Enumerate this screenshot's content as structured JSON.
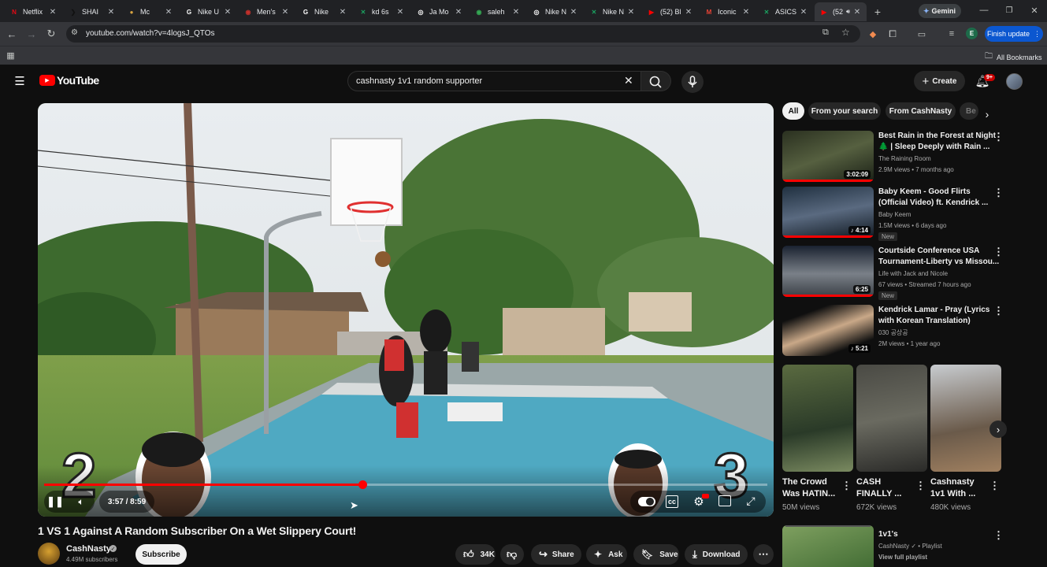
{
  "browser": {
    "tabs": [
      {
        "label": "Netflix",
        "icon": "netflix-icon",
        "color": "#e50914",
        "glyph": "N"
      },
      {
        "label": "SHAI",
        "icon": "shai-icon",
        "color": "#111111",
        "glyph": "❯"
      },
      {
        "label": "Mc",
        "icon": "mc-icon",
        "color": "#d9a441",
        "glyph": "●"
      },
      {
        "label": "Nike U",
        "icon": "google-g-icon",
        "color": "#ffffff",
        "glyph": "G"
      },
      {
        "label": "Men's",
        "icon": "mens-icon",
        "color": "#c4302b",
        "glyph": "◉"
      },
      {
        "label": "Nike",
        "icon": "google-g-icon",
        "color": "#ffffff",
        "glyph": "G"
      },
      {
        "label": "kd 6s",
        "icon": "x-icon",
        "color": "#1aa260",
        "glyph": "✕"
      },
      {
        "label": "Ja Mo",
        "icon": "chatgpt-icon",
        "color": "#ffffff",
        "glyph": "◎"
      },
      {
        "label": "saleh",
        "icon": "chrome-icon",
        "color": "#34a853",
        "glyph": "◉"
      },
      {
        "label": "Nike N",
        "icon": "chatgpt-icon",
        "color": "#ffffff",
        "glyph": "◎"
      },
      {
        "label": "Nike N",
        "icon": "x-icon",
        "color": "#1aa260",
        "glyph": "✕"
      },
      {
        "label": "(52) Bl",
        "icon": "youtube-icon",
        "color": "#ff0000",
        "glyph": "▶"
      },
      {
        "label": "Iconic",
        "icon": "gmail-icon",
        "color": "#ea4335",
        "glyph": "M"
      },
      {
        "label": "ASICS",
        "icon": "x-icon",
        "color": "#1aa260",
        "glyph": "✕"
      },
      {
        "label": "(52",
        "icon": "youtube-icon",
        "color": "#ff0000",
        "glyph": "▶"
      }
    ],
    "gemini_label": "Gemini",
    "url": "youtube.com/watch?v=4logsJ_QTOs",
    "finish_update_label": "Finish update",
    "all_bookmarks_label": "All Bookmarks"
  },
  "youtube": {
    "logo_text": "YouTube",
    "search_value": "cashnasty 1v1 random supporter",
    "create_label": "Create",
    "notification_count": "9+",
    "brand_color": "#ff0000"
  },
  "player": {
    "score_left": "2",
    "score_right": "3",
    "time": "3:57 / 8:59",
    "progress": 0.44
  },
  "video": {
    "title": "1 VS 1 Against A Random Subscriber On a Wet Slippery Court!",
    "channel": "CashNasty",
    "subscribers": "4.49M subscribers",
    "subscribe_label": "Subscribe",
    "likes": "34K",
    "share_label": "Share",
    "ask_label": "Ask",
    "save_label": "Save",
    "download_label": "Download"
  },
  "filters": [
    "All",
    "From your search",
    "From CashNasty",
    "Be"
  ],
  "recommendations": [
    {
      "title1": "Best Rain in the Forest at Night",
      "title2": "🌲 | Sleep Deeply with Rain ...",
      "channel": "The Raining Room",
      "meta": "2.9M views • 7 months ago",
      "duration": "3:02:09",
      "badge": ""
    },
    {
      "title1": "Baby Keem - Good Flirts",
      "title2": "(Official Video) ft. Kendrick ...",
      "channel": "Baby Keem",
      "meta": "1.5M views • 6 days ago",
      "duration": "♪ 4:14",
      "badge": "New"
    },
    {
      "title1": "Courtside Conference USA",
      "title2": "Tournament-Liberty vs Missou...",
      "channel": "Life with Jack and Nicole",
      "meta": "67 views • Streamed 7 hours ago",
      "duration": "6:25",
      "badge": "New"
    },
    {
      "title1": "Kendrick Lamar - Pray (Lyrics",
      "title2": "with Korean Translation)",
      "channel": "030 공상공",
      "meta": "2M views • 1 year ago",
      "duration": "♪ 5:21",
      "badge": ""
    }
  ],
  "shorts": [
    {
      "title1": "The Crowd",
      "title2": "Was HATIN...",
      "views": "50M views"
    },
    {
      "title1": "CASH",
      "title2": "FINALLY ...",
      "views": "672K views"
    },
    {
      "title1": "Cashnasty",
      "title2": "1v1 With ...",
      "views": "480K views"
    }
  ],
  "playlist": {
    "title": "1v1's",
    "channel": "CashNasty",
    "type": "• Playlist",
    "link": "View full playlist"
  }
}
